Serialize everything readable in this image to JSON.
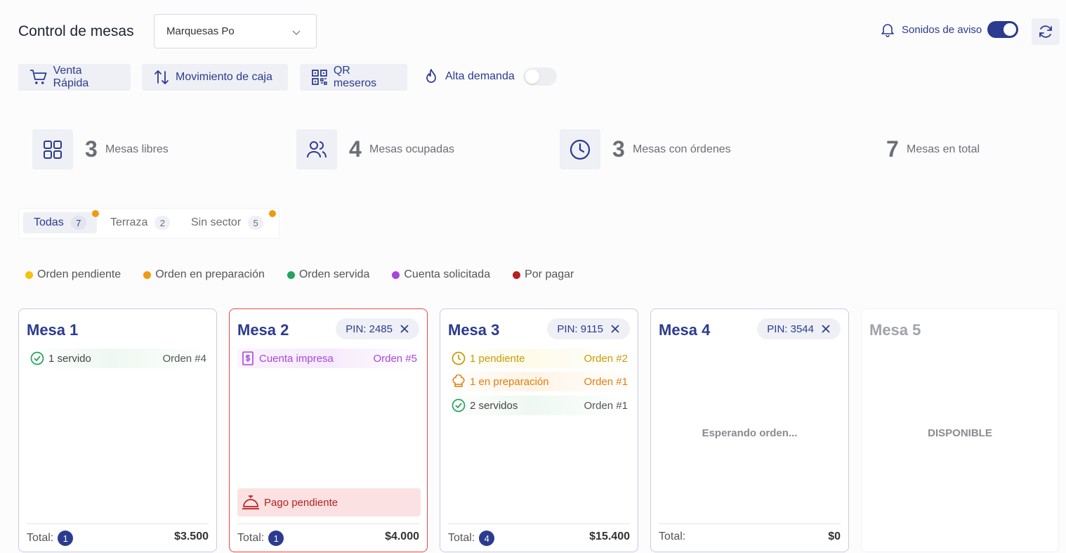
{
  "header": {
    "title": "Control de mesas",
    "location_select": "Marquesas Po",
    "sound_label": "Sonidos de aviso"
  },
  "toolbar": {
    "quick_sale": "Venta Rápida",
    "cash_movement": "Movimiento de caja",
    "qr_waiters": "QR meseros",
    "high_demand": "Alta demanda"
  },
  "stats": [
    {
      "value": "3",
      "label": "Mesas libres",
      "icon": "grid-icon"
    },
    {
      "value": "4",
      "label": "Mesas ocupadas",
      "icon": "users-icon"
    },
    {
      "value": "3",
      "label": "Mesas con órdenes",
      "icon": "clock-icon"
    },
    {
      "value": "7",
      "label": "Mesas en total",
      "icon": ""
    }
  ],
  "tabs": [
    {
      "label": "Todas",
      "count": "7"
    },
    {
      "label": "Terraza",
      "count": "2"
    },
    {
      "label": "Sin sector",
      "count": "5"
    }
  ],
  "legend": [
    {
      "label": "Orden pendiente",
      "color": "#f2c30f"
    },
    {
      "label": "Orden en preparación",
      "color": "#ee9a12"
    },
    {
      "label": "Orden servida",
      "color": "#27a35a"
    },
    {
      "label": "Cuenta solicitada",
      "color": "#a547e0"
    },
    {
      "label": "Por pagar",
      "color": "#b81f1f"
    }
  ],
  "cards": [
    {
      "name": "Mesa 1",
      "rows": [
        {
          "text": "1 servido",
          "order": "Orden #4"
        }
      ],
      "total_label": "Total:",
      "total_count": "1",
      "total_value": "$3.500"
    },
    {
      "name": "Mesa 2",
      "pin": "PIN: 2485",
      "rows": [
        {
          "text": "Cuenta impresa",
          "order": "Orden #5"
        }
      ],
      "payment": "Pago pendiente",
      "total_label": "Total:",
      "total_count": "1",
      "total_value": "$4.000"
    },
    {
      "name": "Mesa 3",
      "pin": "PIN: 9115",
      "rows": [
        {
          "text": "1 pendiente",
          "order": "Orden #2"
        },
        {
          "text": "1 en preparación",
          "order": "Orden #1"
        },
        {
          "text": "2 servidos",
          "order": "Orden #1"
        }
      ],
      "total_label": "Total:",
      "total_count": "4",
      "total_value": "$15.400"
    },
    {
      "name": "Mesa 4",
      "pin": "PIN: 3544",
      "message": "Esperando orden...",
      "total_label": "Total:",
      "total_value": "$0"
    },
    {
      "name": "Mesa 5",
      "message": "DISPONIBLE"
    }
  ]
}
